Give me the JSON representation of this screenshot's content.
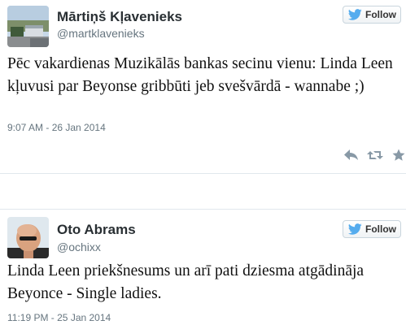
{
  "colors": {
    "twitter_blue": "#55acee",
    "muted": "#66757f",
    "action_gray": "#8899a6"
  },
  "tweets": [
    {
      "name": "Mārtiņš Kļavenieks",
      "handle": "@martklavenieks",
      "follow_label": "Follow",
      "text": "Pēc vakardienas Muzikālās bankas secinu vienu: Linda Leen kļuvusi par Beyonse gribbūti jeb svešvārdā - wannabe ;)",
      "timestamp": "9:07 AM - 26 Jan 2014",
      "actions": [
        "reply-icon",
        "retweet-icon",
        "favorite-icon"
      ]
    },
    {
      "name": "Oto Abrams",
      "handle": "@ochixx",
      "follow_label": "Follow",
      "text": "Linda Leen priekšnesums un arī pati dziesma atgādināja Beyonce - Single ladies.",
      "timestamp": "11:19 PM - 25 Jan 2014"
    }
  ]
}
